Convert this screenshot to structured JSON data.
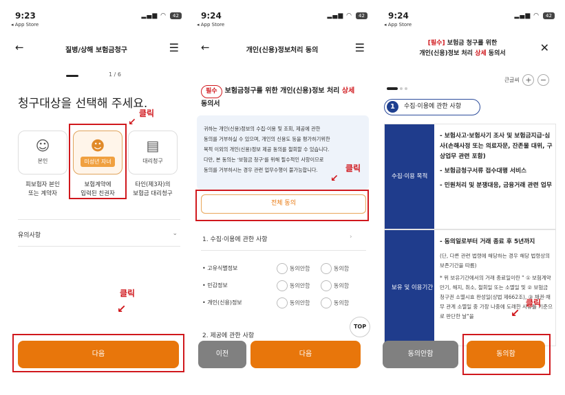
{
  "status": {
    "s1": {
      "time": "9:23",
      "app": "◂ App Store",
      "battery": "42"
    },
    "s2": {
      "time": "9:24",
      "app": "◂ App Store",
      "battery": "42"
    },
    "s3": {
      "time": "9:24",
      "app": "◂ App Store",
      "battery": "42"
    }
  },
  "s1": {
    "title": "질병/상해 보험금청구",
    "progress": "1 / 6",
    "heading": "청구대상을 선택해 주세요.",
    "click_label": "클릭",
    "options": [
      {
        "label": "본인",
        "caption1": "피보험자 본인",
        "caption2": "또는 계약자"
      },
      {
        "label": "미성년 자녀",
        "caption1": "보험계약에",
        "caption2": "입력된 친권자"
      },
      {
        "label": "대리청구",
        "caption1": "타인(제3자)의",
        "caption2": "보험금 대리청구"
      }
    ],
    "notice": "유의사항",
    "next": "다음"
  },
  "s2": {
    "title": "개인(신용)정보처리 동의",
    "required": "필수",
    "heading_a": "보험금청구를 위한 개인(신용)정보 처리 ",
    "heading_red": "상세",
    "heading_b": "동의서",
    "info": [
      "귀하는 개인(신용)정보의 수집·이용 및 조회, 제공에 관한",
      "동의를 거부하실 수 있으며, 개인의 신용도 등을 평가하기위한",
      "목적 이외의 개인(신용)정보 제공 동의를 철회할 수 있습니다.",
      "다만, 본 동의는 '보험금 청구'를 위해 필수적인 사항이므로",
      "동의를 거부하시는 경우 관련 업무수행이 불가능합니다."
    ],
    "agree_all": "전체 동의",
    "section1": "1. 수집·이용에 관한 사항",
    "items": [
      {
        "name": "• 고유식별정보",
        "no": "동의안함",
        "yes": "동의함"
      },
      {
        "name": "• 민감정보",
        "no": "동의안함",
        "yes": "동의함"
      },
      {
        "name": "• 개인(신용)정보",
        "no": "동의안함",
        "yes": "동의함"
      }
    ],
    "top": "TOP",
    "section2": "2. 제공에 관한 사항",
    "click_label": "클릭",
    "prev": "이전",
    "next": "다음"
  },
  "s3": {
    "title_req": "[필수]",
    "title_a": " 보험금 청구를 위한",
    "title_b": "개인(신용)정보 처리 ",
    "title_red": "상세",
    "title_c": " 동의서",
    "font_label": "큰글씨",
    "plus": "+",
    "minus": "−",
    "section_num": "1",
    "section": "수집·이용에 관한 사항",
    "purpose_label": "수집·이용 목적",
    "purpose": [
      "- 보험사고·보험사기 조사 및 보험금지급·심사(손해사정 또는 의료자문, 잔존물 대위, 구상업무 관련 포함)",
      "- 보험금청구서류 접수대행 서비스",
      "- 민원처리 및 분쟁대응, 금융거래 관련 업무"
    ],
    "period_label": "보유 및 이용기간",
    "period_main": "- 동의일로부터 거래 종료 후 5년까지",
    "period_sub": "(단, 다른 관련 법령에 해당하는 경우 해당 법령상의 보존기간을 따름)",
    "period_note": "* 위 보유기간에서의 거래 종료일이란 \" ① 보험계약 만기, 해지, 취소, 철회일 또는 소멸일 및 ② 보험금 청구권 소멸시효 완성일(상법 제662조), ③ 채권·채무 관계 소멸일 중 가장 나중에 도래한 사유를 기준으로 판단한 날\"을",
    "click_label": "클릭",
    "disagree": "동의안함",
    "agree": "동의함"
  }
}
